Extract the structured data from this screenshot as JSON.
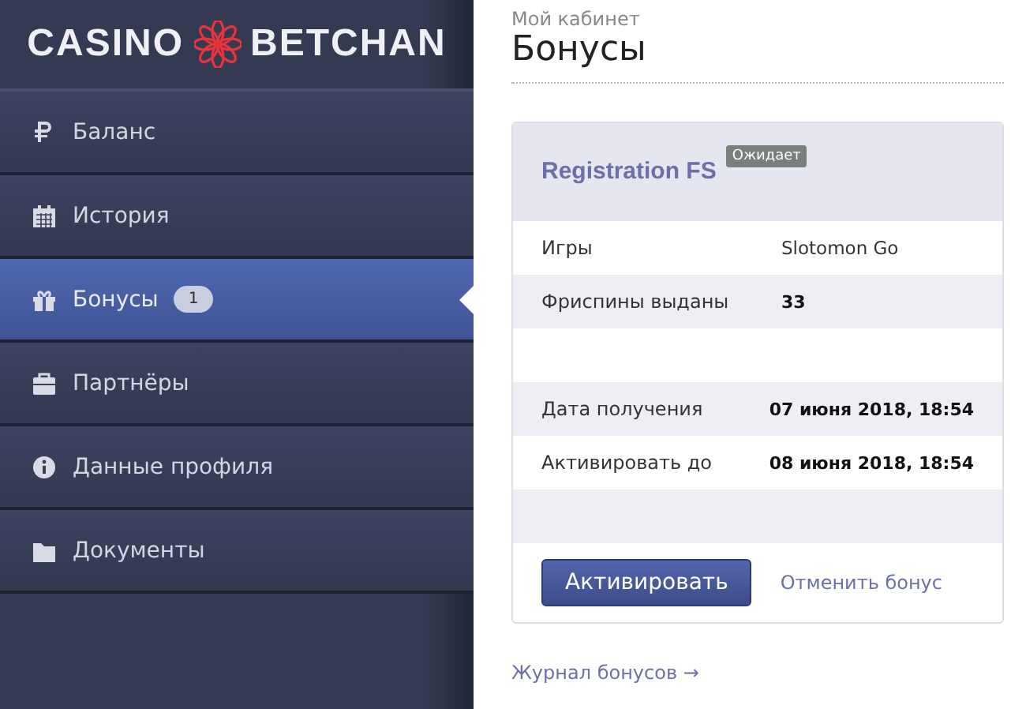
{
  "logo": {
    "left": "CASINO",
    "right": "BETCHAN"
  },
  "sidebar": {
    "items": [
      {
        "label": "Баланс",
        "selected": false
      },
      {
        "label": "История",
        "selected": false
      },
      {
        "label": "Бонусы",
        "selected": true,
        "badge": "1"
      },
      {
        "label": "Партнёры",
        "selected": false
      },
      {
        "label": "Данные профиля",
        "selected": false
      },
      {
        "label": "Документы",
        "selected": false
      }
    ]
  },
  "breadcrumb": "Мой кабинет",
  "page_title": "Бонусы",
  "bonus": {
    "title": "Registration FS",
    "status": "Ожидает",
    "rows": [
      {
        "kind": "field",
        "label": "Игры",
        "value": "Slotomon Go",
        "bold": false
      },
      {
        "kind": "field",
        "label": "Фриспины выданы",
        "value": "33",
        "bold": true
      },
      {
        "kind": "spacer"
      },
      {
        "kind": "field",
        "label": "Дата получения",
        "value": "07 июня 2018, 18:54",
        "bold": true
      },
      {
        "kind": "field",
        "label": "Активировать до",
        "value": "08 июня 2018, 18:54",
        "bold": true
      },
      {
        "kind": "spacer"
      }
    ],
    "primary_button": "Активировать",
    "cancel_link": "Отменить бонус"
  },
  "history_link": "Журнал бонусов →"
}
